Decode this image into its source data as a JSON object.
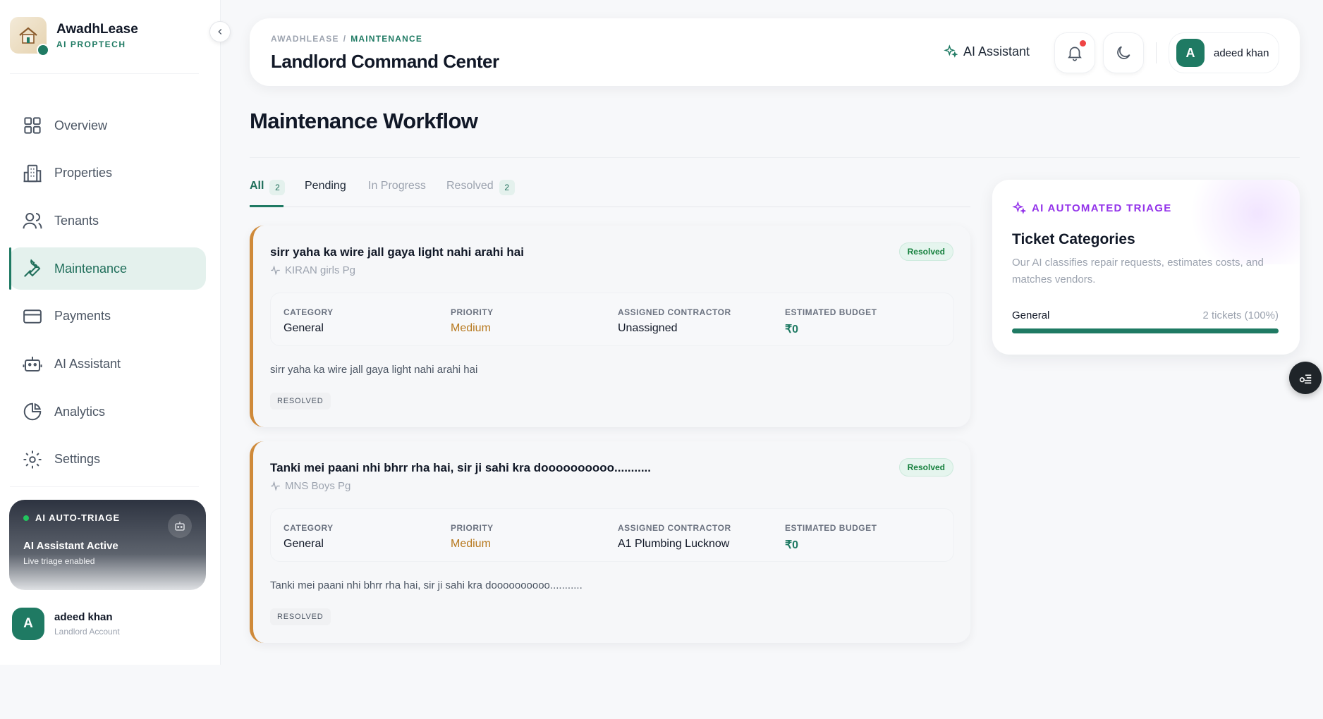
{
  "brand": {
    "name": "AwadhLease",
    "tagline": "AI PROPTECH"
  },
  "sidebar": {
    "items": [
      {
        "label": "Overview",
        "icon": "grid-icon"
      },
      {
        "label": "Properties",
        "icon": "building-icon"
      },
      {
        "label": "Tenants",
        "icon": "users-icon"
      },
      {
        "label": "Maintenance",
        "icon": "wrench-icon",
        "active": true
      },
      {
        "label": "Payments",
        "icon": "credit-card-icon"
      },
      {
        "label": "AI Assistant",
        "icon": "robot-icon"
      },
      {
        "label": "Analytics",
        "icon": "pie-chart-icon"
      },
      {
        "label": "Settings",
        "icon": "gear-icon"
      }
    ],
    "triage": {
      "badge": "AI AUTO-TRIAGE",
      "title": "AI Assistant Active",
      "subtitle": "Live triage enabled"
    },
    "user": {
      "initial": "A",
      "name": "adeed khan",
      "role": "Landlord Account"
    }
  },
  "header": {
    "breadcrumb": [
      "AWADHLEASE",
      "MAINTENANCE"
    ],
    "breadcrumb_sep": "/",
    "title": "Landlord Command Center",
    "ai_button": "AI Assistant",
    "user": {
      "initial": "A",
      "name": "adeed khan"
    }
  },
  "page": {
    "title": "Maintenance Workflow",
    "tabs": [
      {
        "label": "All",
        "count": "2",
        "active": true
      },
      {
        "label": "Pending"
      },
      {
        "label": "In Progress"
      },
      {
        "label": "Resolved",
        "count": "2"
      }
    ]
  },
  "labels": {
    "category": "CATEGORY",
    "priority": "PRIORITY",
    "contractor": "ASSIGNED CONTRACTOR",
    "budget": "ESTIMATED BUDGET"
  },
  "tickets": [
    {
      "title": "sirr yaha ka wire jall gaya light nahi arahi hai",
      "property": "KIRAN girls Pg",
      "status": "Resolved",
      "category": "General",
      "priority": "Medium",
      "contractor": "Unassigned",
      "budget": "₹0",
      "description": "sirr yaha ka wire jall gaya light nahi arahi hai",
      "tag": "RESOLVED"
    },
    {
      "title": "Tanki mei paani nhi bhrr rha hai, sir ji sahi kra doooooooooo...........",
      "property": "MNS Boys Pg",
      "status": "Resolved",
      "category": "General",
      "priority": "Medium",
      "contractor": "A1 Plumbing Lucknow",
      "budget": "₹0",
      "description": "Tanki mei paani nhi bhrr rha hai, sir ji sahi kra doooooooooo...........",
      "tag": "RESOLVED"
    }
  ],
  "triage_panel": {
    "badge": "AI AUTOMATED TRIAGE",
    "title": "Ticket Categories",
    "description": "Our AI classifies repair requests, estimates costs, and matches vendors.",
    "categories": [
      {
        "name": "General",
        "count_text": "2 tickets (100%)",
        "share": 1.0
      }
    ]
  },
  "colors": {
    "accent": "#1f7a63",
    "accent_light": "#e4f1ed",
    "priority_medium": "#b7791f",
    "ai_purple": "#9333ea",
    "ticket_border": "#cf8a3a"
  }
}
